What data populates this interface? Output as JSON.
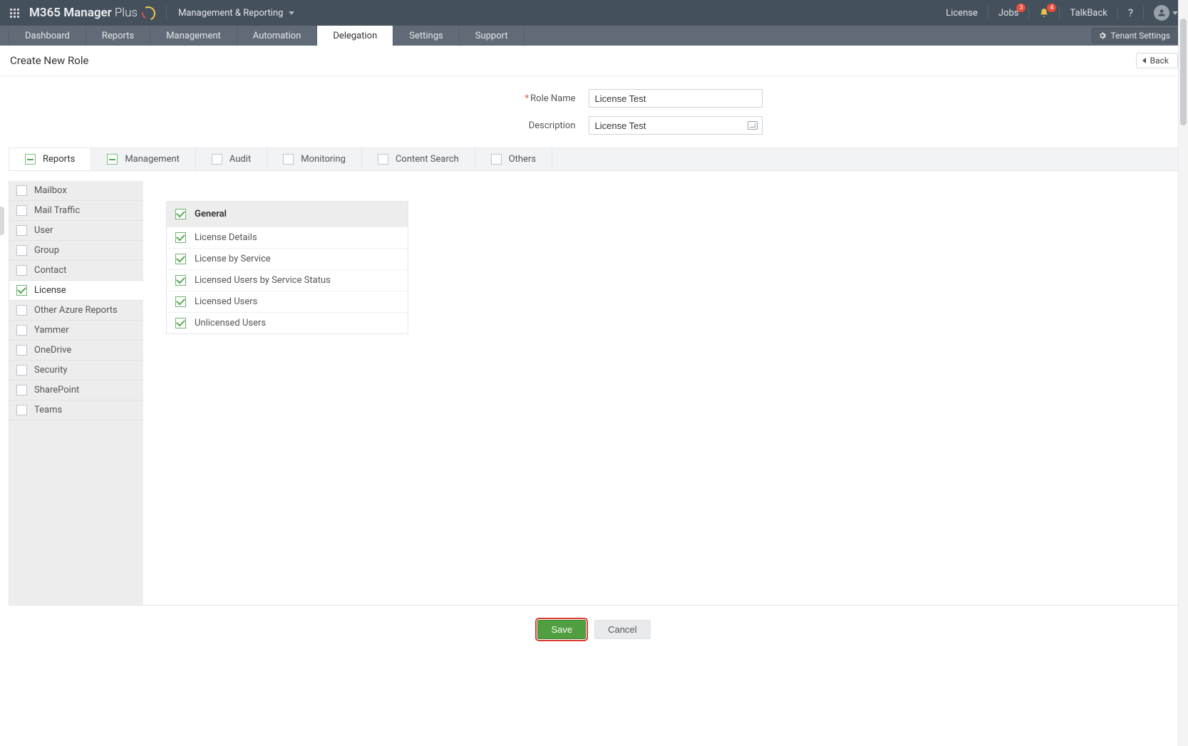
{
  "header": {
    "brand_main": "M365 Manager",
    "brand_suffix": "Plus",
    "module": "Management & Reporting",
    "links": {
      "license": "License",
      "jobs": "Jobs",
      "talkback": "TalkBack"
    },
    "badges": {
      "jobs": "3",
      "bell": "4"
    }
  },
  "nav": {
    "tabs": [
      "Dashboard",
      "Reports",
      "Management",
      "Automation",
      "Delegation",
      "Settings",
      "Support"
    ],
    "active": "Delegation",
    "tenant_button": "Tenant Settings"
  },
  "page": {
    "title": "Create New Role",
    "back": "Back"
  },
  "form": {
    "role_label": "Role Name",
    "role_value": "License Test",
    "desc_label": "Description",
    "desc_value": "License Test"
  },
  "cat_tabs": [
    {
      "label": "Reports",
      "state": "partial",
      "active": true
    },
    {
      "label": "Management",
      "state": "partial",
      "active": false
    },
    {
      "label": "Audit",
      "state": "",
      "active": false
    },
    {
      "label": "Monitoring",
      "state": "",
      "active": false
    },
    {
      "label": "Content Search",
      "state": "",
      "active": false
    },
    {
      "label": "Others",
      "state": "",
      "active": false
    }
  ],
  "side_items": [
    {
      "label": "Mailbox",
      "state": ""
    },
    {
      "label": "Mail Traffic",
      "state": ""
    },
    {
      "label": "User",
      "state": ""
    },
    {
      "label": "Group",
      "state": ""
    },
    {
      "label": "Contact",
      "state": ""
    },
    {
      "label": "License",
      "state": "checked",
      "active": true
    },
    {
      "label": "Other Azure Reports",
      "state": ""
    },
    {
      "label": "Yammer",
      "state": ""
    },
    {
      "label": "OneDrive",
      "state": ""
    },
    {
      "label": "Security",
      "state": ""
    },
    {
      "label": "SharePoint",
      "state": ""
    },
    {
      "label": "Teams",
      "state": ""
    }
  ],
  "perm_header": "General",
  "perms": [
    "License Details",
    "License by Service",
    "Licensed Users by Service Status",
    "Licensed Users",
    "Unlicensed Users"
  ],
  "footer": {
    "save": "Save",
    "cancel": "Cancel"
  }
}
